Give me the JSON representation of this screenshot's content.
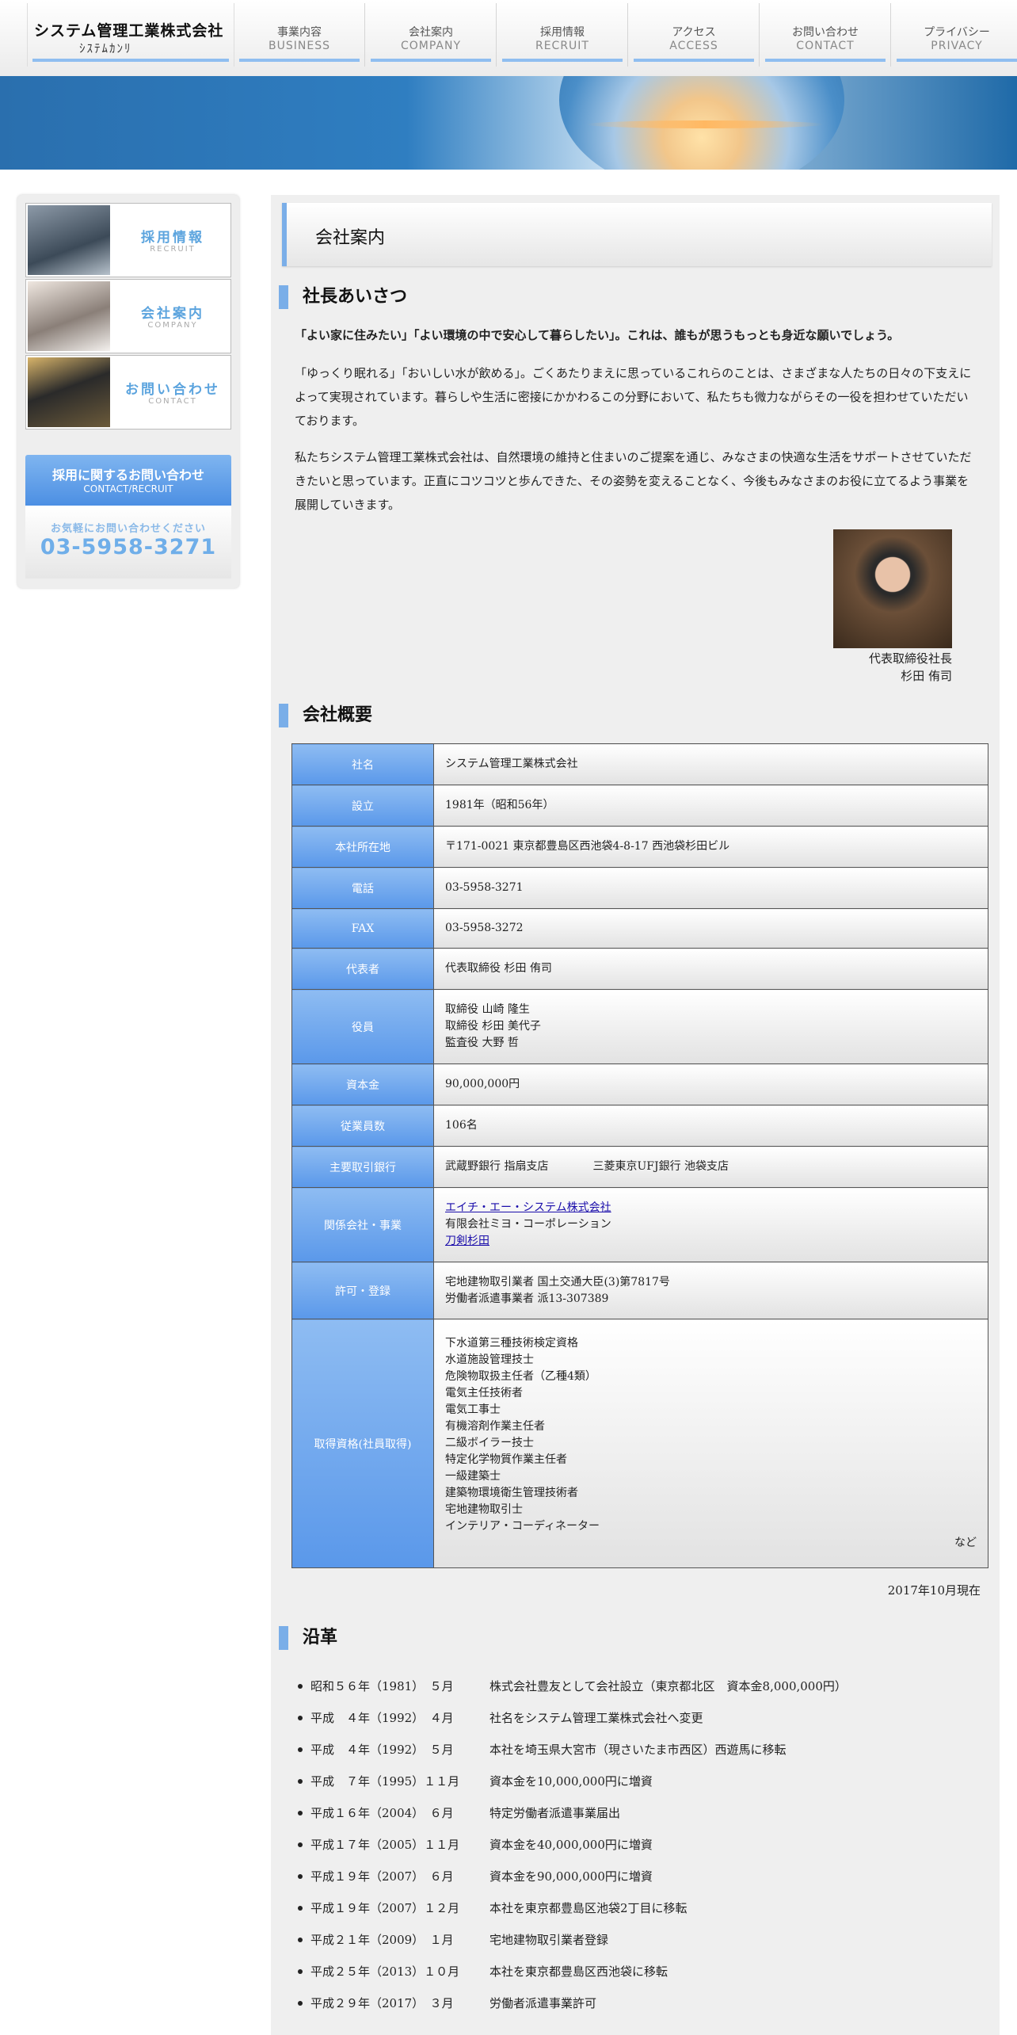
{
  "header": {
    "logo_name": "システム管理工業株式会社",
    "logo_sub": "ｼｽﾃﾑｶﾝﾘ",
    "nav": [
      {
        "ja": "事業内容",
        "en": "BUSINESS"
      },
      {
        "ja": "会社案内",
        "en": "COMPANY"
      },
      {
        "ja": "採用情報",
        "en": "RECRUIT"
      },
      {
        "ja": "アクセス",
        "en": "ACCESS"
      },
      {
        "ja": "お問い合わせ",
        "en": "CONTACT"
      },
      {
        "ja": "プライバシー",
        "en": "PRIVACY"
      }
    ]
  },
  "sidebar": {
    "links": [
      {
        "ja": "採用情報",
        "en": "RECRUIT"
      },
      {
        "ja": "会社案内",
        "en": "COMPANY"
      },
      {
        "ja": "お問い合わせ",
        "en": "CONTACT"
      }
    ],
    "inquiry": {
      "title": "採用に関するお問い合わせ",
      "en": "CONTACT/RECRUIT",
      "note": "お気軽にお問い合わせください",
      "tel": "03-5958-3271"
    }
  },
  "main": {
    "page_title": "会社案内",
    "greeting": {
      "heading": "社長あいさつ",
      "lead": "「よい家に住みたい」「よい環境の中で安心して暮らしたい」。これは、誰もが思うもっとも身近な願いでしょう。",
      "p1": "「ゆっくり眠れる」「おいしい水が飲める」。ごくあたりまえに思っているこれらのことは、さまざまな人たちの日々の下支えによって実現されています。暮らしや生活に密接にかかわるこの分野において、私たちも微力ながらその一役を担わせていただいております。",
      "p2": "私たちシステム管理工業株式会社は、自然環境の維持と住まいのご提案を通じ、みなさまの快適な生活をサポートさせていただきたいと思っています。正直にコツコツと歩んできた、その姿勢を変えることなく、今後もみなさまのお役に立てるよう事業を展開していきます。",
      "caption_role": "代表取締役社長",
      "caption_name": "杉田 侑司"
    },
    "overview": {
      "heading": "会社概要",
      "rows": [
        {
          "label": "社名",
          "lines": [
            "システム管理工業株式会社"
          ]
        },
        {
          "label": "設立",
          "lines": [
            "1981年（昭和56年）"
          ]
        },
        {
          "label": "本社所在地",
          "lines": [
            "〒171-0021 東京都豊島区西池袋4-8-17 西池袋杉田ビル"
          ]
        },
        {
          "label": "電話",
          "lines": [
            "03-5958-3271"
          ]
        },
        {
          "label": "FAX",
          "lines": [
            "03-5958-3272"
          ]
        },
        {
          "label": "代表者",
          "lines": [
            "代表取締役 杉田 侑司"
          ]
        },
        {
          "label": "役員",
          "lines": [
            "取締役 山崎 隆生",
            "取締役 杉田 美代子",
            "監査役 大野 哲"
          ]
        },
        {
          "label": "資本金",
          "lines": [
            "90,000,000円"
          ]
        },
        {
          "label": "従業員数",
          "lines": [
            "106名"
          ]
        },
        {
          "label": "主要取引銀行",
          "lines": [
            "武蔵野銀行 指扇支店　　　　三菱東京UFJ銀行 池袋支店"
          ]
        },
        {
          "label": "関係会社・事業",
          "link1": "エイチ・エー・システム株式会社",
          "plain": "有限会社ミヨ・コーポレーション",
          "link2": "刀剣杉田"
        },
        {
          "label": "許可・登録",
          "lines": [
            "宅地建物取引業者 国土交通大臣(3)第7817号",
            "労働者派遣事業者 派13-307389"
          ]
        },
        {
          "label": "取得資格(社員取得)",
          "lines": [
            "下水道第三種技術検定資格",
            "水道施設管理技士",
            "危険物取扱主任者（乙種4類）",
            "電気主任技術者",
            "電気工事士",
            "有機溶剤作業主任者",
            "二級ボイラー技士",
            "特定化学物質作業主任者",
            "一級建築士",
            "建築物環境衛生管理技術者",
            "宅地建物取引士",
            "インテリア・コーディネーター"
          ],
          "suffix": "など"
        }
      ],
      "as_of": "2017年10月現在"
    },
    "history": {
      "heading": "沿革",
      "items": [
        {
          "date": "昭和５６年（1981）　５月",
          "text": "株式会社豊友として会社設立（東京都北区　資本金8,000,000円）"
        },
        {
          "date": "平成　４年（1992）　４月",
          "text": "社名をシステム管理工業株式会社へ変更"
        },
        {
          "date": "平成　４年（1992）　５月",
          "text": "本社を埼玉県大宮市（現さいたま市西区）西遊馬に移転"
        },
        {
          "date": "平成　７年（1995）１１月",
          "text": "資本金を10,000,000円に増資"
        },
        {
          "date": "平成１６年（2004）　６月",
          "text": "特定労働者派遣事業届出"
        },
        {
          "date": "平成１７年（2005）１１月",
          "text": "資本金を40,000,000円に増資"
        },
        {
          "date": "平成１９年（2007）　６月",
          "text": "資本金を90,000,000円に増資"
        },
        {
          "date": "平成１９年（2007）１２月",
          "text": "本社を東京都豊島区池袋2丁目に移転"
        },
        {
          "date": "平成２１年（2009）　１月",
          "text": "宅地建物取引業者登録"
        },
        {
          "date": "平成２５年（2013）１０月",
          "text": "本社を東京都豊島区西池袋に移転"
        },
        {
          "date": "平成２９年（2017）　３月",
          "text": "労働者派遣事業許可"
        }
      ]
    }
  }
}
